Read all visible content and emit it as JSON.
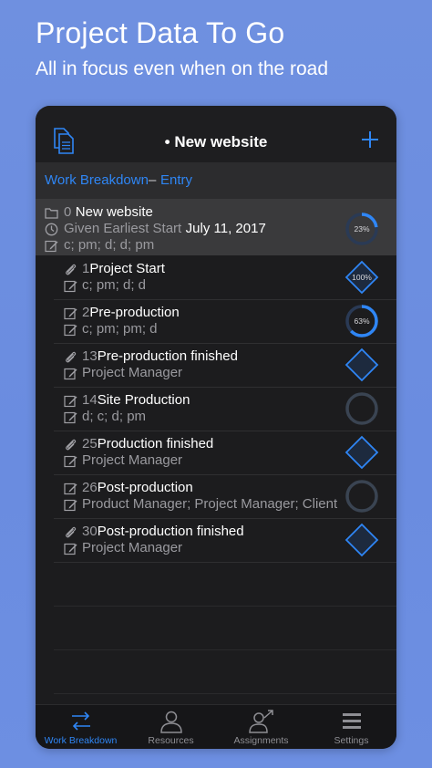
{
  "hero": {
    "title": "Project Data To Go",
    "subtitle": "All in focus even when on the road"
  },
  "navbar": {
    "title": "• New website",
    "add_icon": "plus-icon",
    "documents_icon": "documents-icon"
  },
  "breadcrumb": {
    "items": [
      "Work Breakdown",
      "Entry"
    ],
    "separator": "–"
  },
  "root": {
    "id": "0",
    "name": "New website",
    "date_label": "Given Earliest Start",
    "date_value": "July 11, 2017",
    "resources": "c; pm; d; d; pm",
    "progress_label": "23%",
    "progress": 0.23
  },
  "tasks": [
    {
      "id": "1",
      "name": "Project Start",
      "detail": "c; pm; d; d",
      "type": "milestone",
      "attach": true,
      "progress_label": "100%"
    },
    {
      "id": "2",
      "name": "Pre-production",
      "detail": "c; pm; pm; d",
      "type": "task",
      "attach": false,
      "progress_label": "63%",
      "progress": 0.63
    },
    {
      "id": "13",
      "name": "Pre-production finished",
      "detail": "Project Manager",
      "type": "milestone",
      "attach": true,
      "progress_label": ""
    },
    {
      "id": "14",
      "name": "Site Production",
      "detail": "d; c; d; pm",
      "type": "task",
      "attach": false,
      "progress_label": "",
      "progress": 0
    },
    {
      "id": "25",
      "name": "Production finished",
      "detail": "Project Manager",
      "type": "milestone",
      "attach": true,
      "progress_label": ""
    },
    {
      "id": "26",
      "name": "Post-production",
      "detail": "Product Manager; Project Manager; Client",
      "type": "task",
      "attach": false,
      "progress_label": "",
      "progress": 0
    },
    {
      "id": "30",
      "name": "Post-production finished",
      "detail": "Project Manager",
      "type": "milestone",
      "attach": true,
      "progress_label": ""
    }
  ],
  "tabbar": {
    "tabs": [
      {
        "label": "Work Breakdown",
        "icon": "work-breakdown-icon",
        "active": true
      },
      {
        "label": "Resources",
        "icon": "person-icon",
        "active": false
      },
      {
        "label": "Assignments",
        "icon": "assignment-icon",
        "active": false
      },
      {
        "label": "Settings",
        "icon": "menu-icon",
        "active": false
      }
    ]
  },
  "colors": {
    "accent": "#2f86f5",
    "background": "#6f90e0",
    "panel": "#1c1c1e",
    "root_row": "#3a3a3c"
  }
}
